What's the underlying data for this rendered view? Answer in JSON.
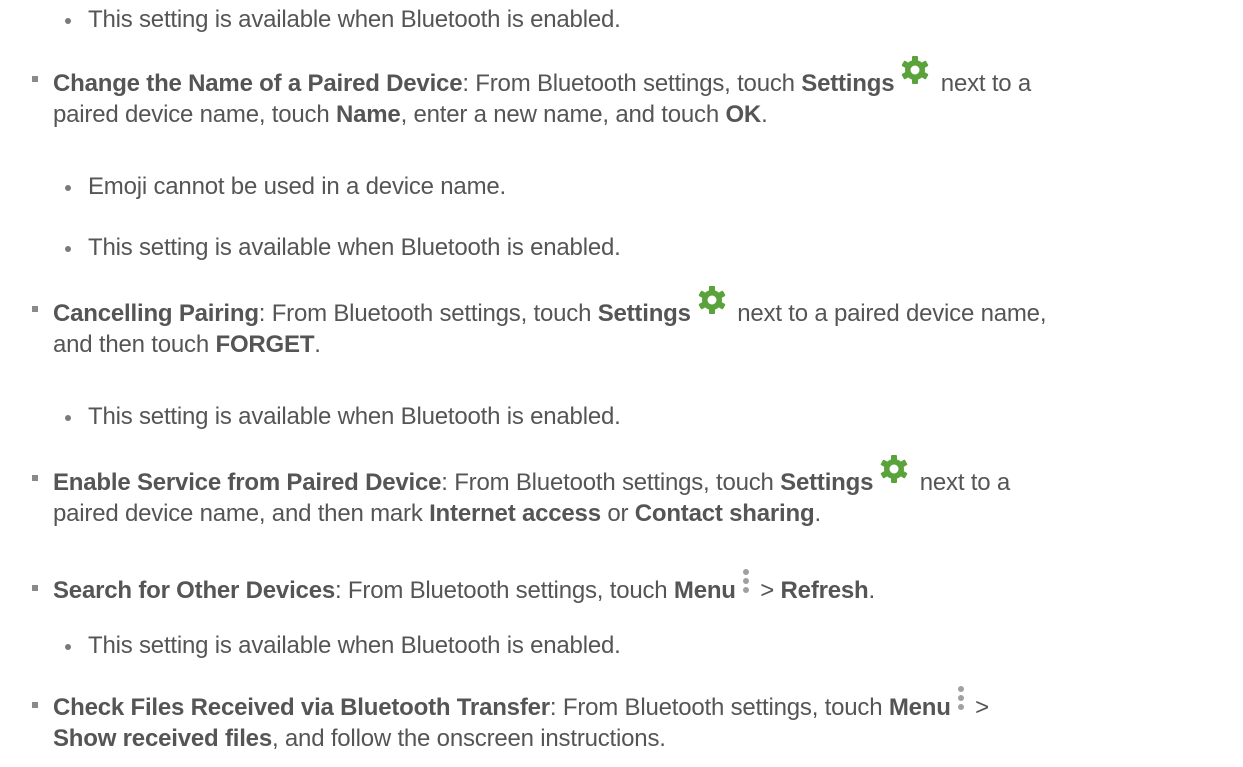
{
  "colors": {
    "text": "#555555",
    "icon": "#5aa23a",
    "menu_icon": "#a0a0a0",
    "bullet": "#8a8a8a"
  },
  "items": {
    "s0": "This setting is available when Bluetooth is enabled.",
    "i1": {
      "bold": "Change the Name of a Paired Device",
      "t1": ": From Bluetooth settings, touch ",
      "b_settings": "Settings",
      "t2": " next to a",
      "t3": "paired device name, touch ",
      "b_name": "Name",
      "t4": ", enter a new name, and touch ",
      "b_ok": "OK",
      "t5": "."
    },
    "s1a": "Emoji cannot be used in a device name.",
    "s1b": "This setting is available when Bluetooth is enabled.",
    "i2": {
      "bold": "Cancelling Pairing",
      "t1": ": From Bluetooth settings, touch ",
      "b_settings": "Settings",
      "t2": " next to a paired device name,",
      "t3": "and then touch ",
      "b_forget": "FORGET",
      "t4": "."
    },
    "s2": "This setting is available when Bluetooth is enabled.",
    "i3": {
      "bold": "Enable Service from Paired Device",
      "t1": ": From Bluetooth settings, touch ",
      "b_settings": "Settings",
      "t2": " next to a",
      "t3": "paired device name, and then mark ",
      "b_internet": "Internet access",
      "t4": " or ",
      "b_contact": "Contact sharing",
      "t5": "."
    },
    "i4": {
      "bold": "Search for Other Devices",
      "t1": ": From Bluetooth settings, touch ",
      "b_menu": "Menu",
      "t2": " > ",
      "b_refresh": "Refresh",
      "t3": "."
    },
    "s4": "This setting is available when Bluetooth is enabled.",
    "i5": {
      "bold": "Check Files Received via Bluetooth Transfer",
      "t1": ": From Bluetooth settings, touch ",
      "b_menu": "Menu",
      "t2": " >",
      "b_show": "Show received files",
      "t3": ", and follow the onscreen instructions."
    }
  }
}
